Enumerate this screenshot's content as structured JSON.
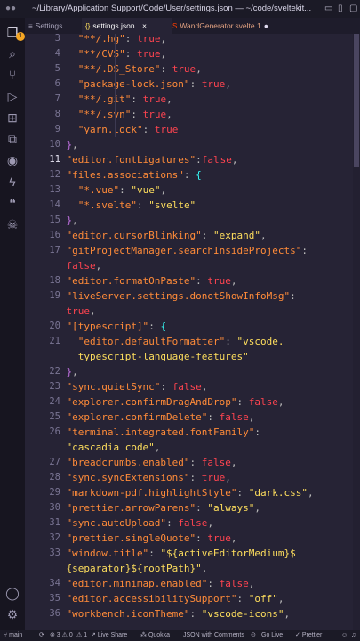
{
  "window": {
    "title": "~/Library/Application Support/Code/User/settings.json — ~/code/sveltekit..."
  },
  "tabs": [
    {
      "label": "Settings",
      "icon": "≡"
    },
    {
      "label": "settings.json",
      "icon": "{}",
      "close": "×"
    },
    {
      "label": "WandGenerator.svelte 1",
      "icon": "S",
      "dirty": "●"
    }
  ],
  "activity": {
    "badge": "1"
  },
  "colors": {
    "background": "#262335",
    "string": "#ff8b39",
    "value": "#fede5d",
    "literal": "#fe4450",
    "lineNumber": "#7a7594"
  },
  "editor": {
    "lines": [
      {
        "n": "3",
        "t1": "\"**/.hg\"",
        "t2": ": ",
        "t3": "true",
        "t4": ","
      },
      {
        "n": "4",
        "t1": "\"**/CVS\"",
        "t2": ": ",
        "t3": "true",
        "t4": ","
      },
      {
        "n": "5",
        "t1": "\"**/.DS_Store\"",
        "t2": ": ",
        "t3": "true",
        "t4": ","
      },
      {
        "n": "6",
        "t1": "\"package-lock.json\"",
        "t2": ": ",
        "t3": "true",
        "t4": ","
      },
      {
        "n": "7",
        "t1": "\"**/.git\"",
        "t2": ": ",
        "t3": "true",
        "t4": ","
      },
      {
        "n": "8",
        "t1": "\"**/.svn\"",
        "t2": ": ",
        "t3": "true",
        "t4": ","
      },
      {
        "n": "9",
        "t1": "\"yarn.lock\"",
        "t2": ": ",
        "t3": "true",
        "t4": ""
      },
      {
        "n": "10",
        "t1": "}",
        "t2": ",",
        "t3": "",
        "t4": ""
      },
      {
        "n": "11",
        "t1": "\"editor.fontLigatures\"",
        "t2": ":",
        "t3": "fal",
        "t3b": "se",
        "t4": ","
      },
      {
        "n": "12",
        "t1": "\"files.associations\"",
        "t2": ": ",
        "t3": "{",
        "t4": ""
      },
      {
        "n": "13",
        "t1": "\"*.vue\"",
        "t2": ": ",
        "t3": "\"vue\"",
        "t4": ","
      },
      {
        "n": "14",
        "t1": "\"*.svelte\"",
        "t2": ": ",
        "t3": "\"svelte\"",
        "t4": ""
      },
      {
        "n": "15",
        "t1": "}",
        "t2": ",",
        "t3": "",
        "t4": ""
      },
      {
        "n": "16",
        "t1": "\"editor.cursorBlinking\"",
        "t2": ": ",
        "t3": "\"expand\"",
        "t4": ","
      },
      {
        "n": "17",
        "t1": "\"gitProjectManager.searchInsideProjects\"",
        "t2": ":",
        "t3": "",
        "t4": ""
      },
      {
        "n": "",
        "t1": "",
        "t2": "",
        "t3": "false",
        "t4": ","
      },
      {
        "n": "18",
        "t1": "\"editor.formatOnPaste\"",
        "t2": ": ",
        "t3": "true",
        "t4": ","
      },
      {
        "n": "19",
        "t1": "\"liveServer.settings.donotShowInfoMsg\"",
        "t2": ":",
        "t3": "",
        "t4": ""
      },
      {
        "n": "",
        "t1": "",
        "t2": "",
        "t3": "true",
        "t4": ","
      },
      {
        "n": "20",
        "t1": "\"[typescript]\"",
        "t2": ": ",
        "t3": "{",
        "t4": ""
      },
      {
        "n": "21",
        "t1": "\"editor.defaultFormatter\"",
        "t2": ": ",
        "t3": "\"vscode.",
        "t4": ""
      },
      {
        "n": "",
        "t1": "",
        "t2": "",
        "t3": "typescript-language-features\"",
        "t4": ""
      },
      {
        "n": "22",
        "t1": "}",
        "t2": ",",
        "t3": "",
        "t4": ""
      },
      {
        "n": "23",
        "t1": "\"sync.quietSync\"",
        "t2": ": ",
        "t3": "false",
        "t4": ","
      },
      {
        "n": "24",
        "t1": "\"explorer.confirmDragAndDrop\"",
        "t2": ": ",
        "t3": "false",
        "t4": ","
      },
      {
        "n": "25",
        "t1": "\"explorer.confirmDelete\"",
        "t2": ": ",
        "t3": "false",
        "t4": ","
      },
      {
        "n": "26",
        "t1": "\"terminal.integrated.fontFamily\"",
        "t2": ":",
        "t3": "",
        "t4": ""
      },
      {
        "n": "",
        "t1": "",
        "t2": "",
        "t3": "\"cascadia code\"",
        "t4": ","
      },
      {
        "n": "27",
        "t1": "\"breadcrumbs.enabled\"",
        "t2": ": ",
        "t3": "false",
        "t4": ","
      },
      {
        "n": "28",
        "t1": "\"sync.syncExtensions\"",
        "t2": ": ",
        "t3": "true",
        "t4": ","
      },
      {
        "n": "29",
        "t1": "\"markdown-pdf.highlightStyle\"",
        "t2": ": ",
        "t3": "\"dark.css\"",
        "t4": ","
      },
      {
        "n": "30",
        "t1": "\"prettier.arrowParens\"",
        "t2": ": ",
        "t3": "\"always\"",
        "t4": ","
      },
      {
        "n": "31",
        "t1": "\"sync.autoUpload\"",
        "t2": ": ",
        "t3": "false",
        "t4": ","
      },
      {
        "n": "32",
        "t1": "\"prettier.singleQuote\"",
        "t2": ": ",
        "t3": "true",
        "t4": ","
      },
      {
        "n": "33",
        "t1": "\"window.title\"",
        "t2": ": ",
        "t3": "\"${activeEditorMedium}$",
        "t4": ""
      },
      {
        "n": "",
        "t1": "",
        "t2": "",
        "t3": "{separator}${rootPath}\"",
        "t4": ","
      },
      {
        "n": "34",
        "t1": "\"editor.minimap.enabled\"",
        "t2": ": ",
        "t3": "false",
        "t4": ","
      },
      {
        "n": "35",
        "t1": "\"editor.accessibilitySupport\"",
        "t2": ": ",
        "t3": "\"off\"",
        "t4": ","
      },
      {
        "n": "36",
        "t1": "\"workbench.iconTheme\"",
        "t2": ": ",
        "t3": "\"vscode-icons\"",
        "t4": ","
      }
    ]
  },
  "status": {
    "branch": "main",
    "problems": "⊗ 3 ⚠ 0",
    "warn2": "⚠ 1",
    "liveShare": "Live Share",
    "quokka": "Quokka",
    "language": "JSON with Comments",
    "goLive": "Go Live",
    "prettier": "Prettier"
  }
}
